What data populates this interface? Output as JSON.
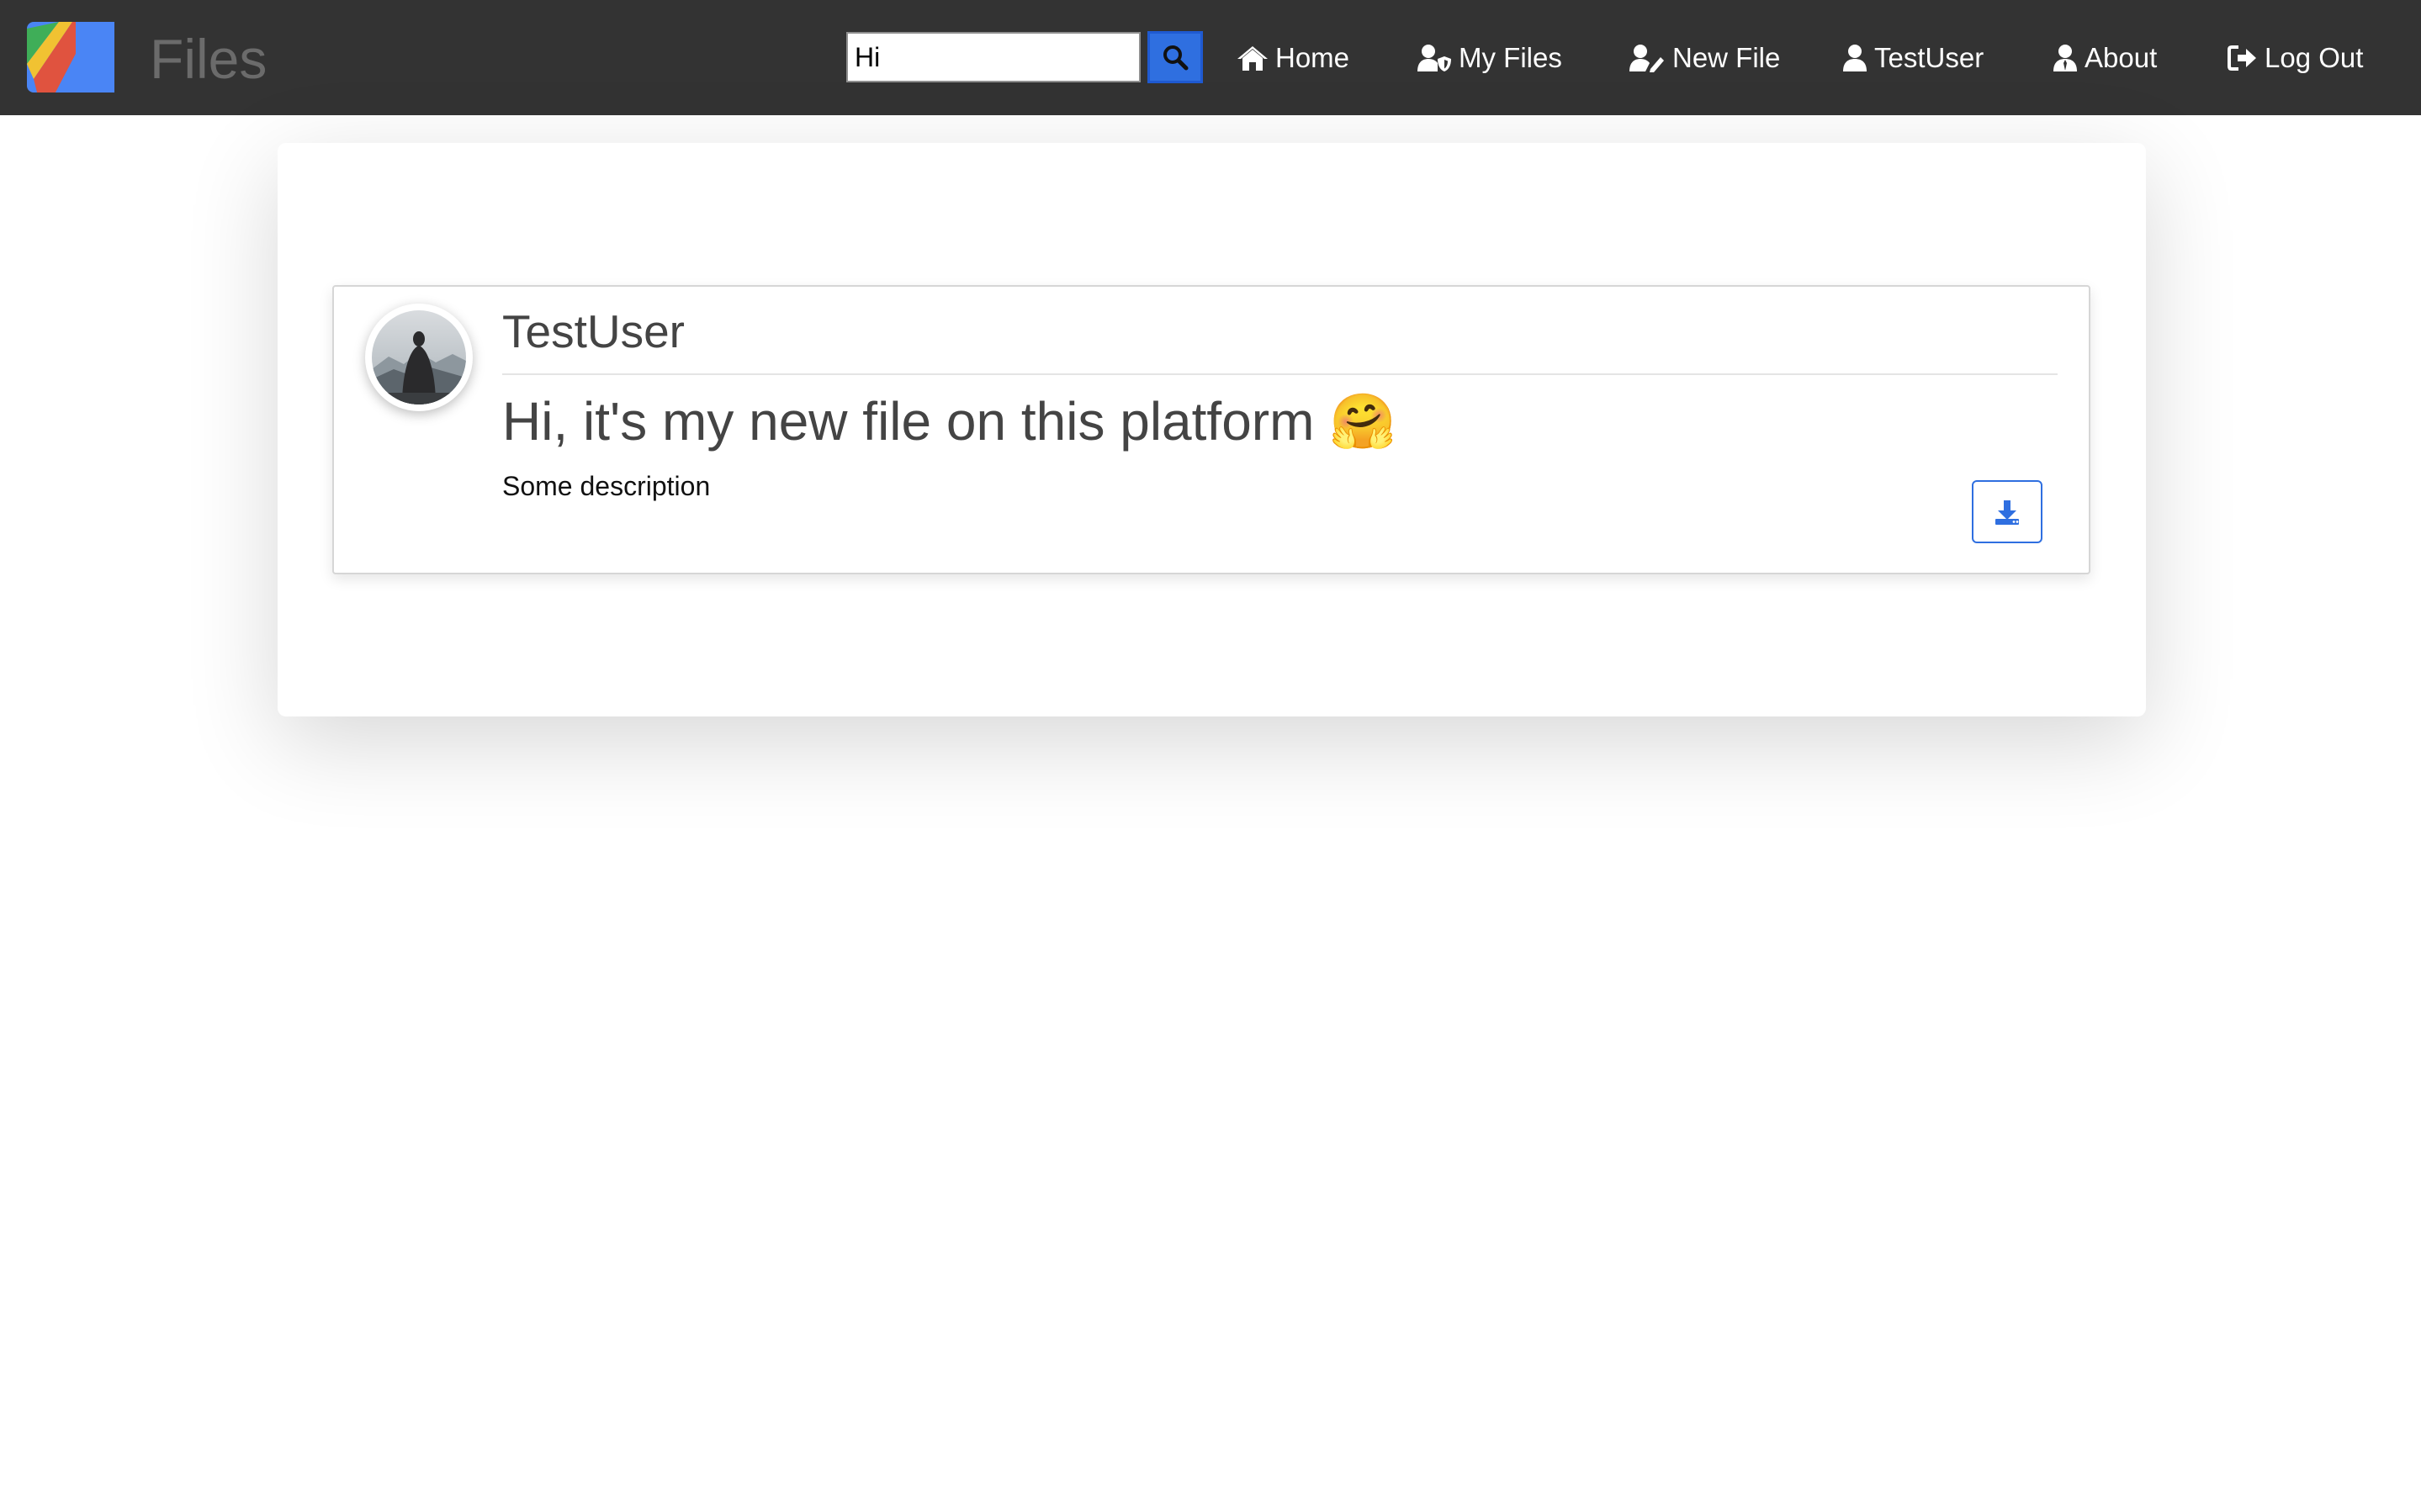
{
  "brand": {
    "name": "Files",
    "logo_icon": "files-logo-icon"
  },
  "search": {
    "value": "Hi",
    "placeholder": "",
    "button_icon": "search-icon"
  },
  "nav": {
    "home": "Home",
    "my_files": "My Files",
    "new_file": "New File",
    "user": "TestUser",
    "about": "About",
    "logout": "Log Out"
  },
  "file": {
    "author": "TestUser",
    "title": "Hi, it's my new file on this platform 🤗",
    "description": "Some description",
    "download_icon": "download-icon"
  },
  "colors": {
    "navbar": "#333333",
    "accent": "#2f6fe0",
    "text": "#444444"
  }
}
